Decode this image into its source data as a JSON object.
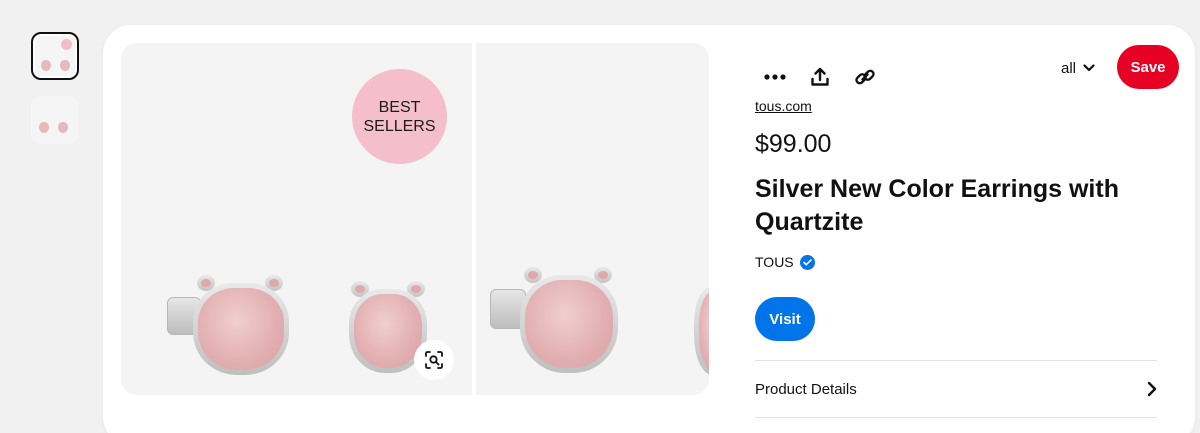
{
  "thumbnails": [
    "Product image 1",
    "Product image 2"
  ],
  "gallery": {
    "badge_line1": "BEST",
    "badge_line2": "SELLERS"
  },
  "actions": {
    "more_icon": "more-dots-icon",
    "share_icon": "share-icon",
    "link_icon": "link-icon",
    "board_label": "all",
    "save_label": "Save"
  },
  "product": {
    "domain": "tous.com",
    "price": "$99.00",
    "title": "Silver New Color Earrings with Quartzite",
    "brand": "TOUS",
    "visit_label": "Visit",
    "details_label": "Product Details"
  },
  "colors": {
    "save": "#e60023",
    "visit": "#0074e8",
    "verified": "#0074e8",
    "badge": "#f4bfca",
    "stone": "#e3b1b3"
  }
}
